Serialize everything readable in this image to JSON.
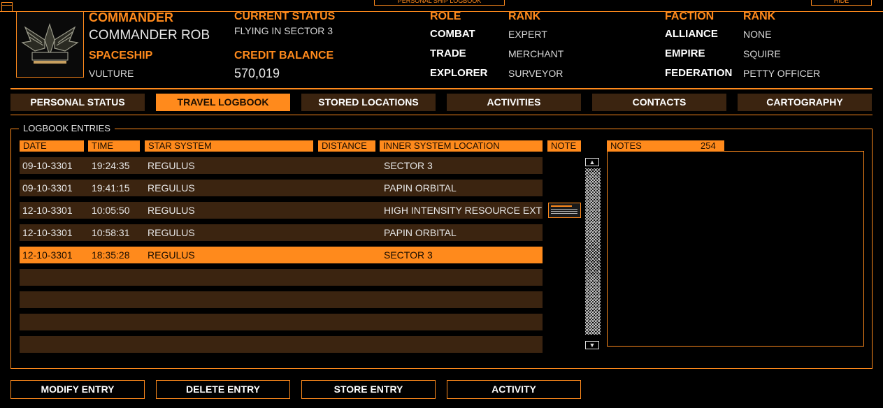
{
  "window": {
    "title": "PERSONAL SHIP LOGBOOK",
    "hide_label": "HIDE"
  },
  "commander": {
    "label": "COMMANDER",
    "name": "COMMANDER ROB",
    "ship_label": "SPACESHIP",
    "ship": "VULTURE",
    "status_label": "CURRENT STATUS",
    "status": "FLYING IN SECTOR 3",
    "credit_label": "CREDIT BALANCE",
    "credits": "570,019"
  },
  "roles": {
    "role_header": "ROLE",
    "rank_header": "RANK",
    "items": [
      {
        "role": "COMBAT",
        "rank": "EXPERT"
      },
      {
        "role": "TRADE",
        "rank": "MERCHANT"
      },
      {
        "role": "EXPLORER",
        "rank": "SURVEYOR"
      }
    ]
  },
  "factions": {
    "faction_header": "FACTION",
    "rank_header": "RANK",
    "items": [
      {
        "faction": "ALLIANCE",
        "rank": "NONE"
      },
      {
        "faction": "EMPIRE",
        "rank": "SQUIRE"
      },
      {
        "faction": "FEDERATION",
        "rank": "PETTY OFFICER"
      }
    ]
  },
  "tabs": [
    "PERSONAL STATUS",
    "TRAVEL LOGBOOK",
    "STORED LOCATIONS",
    "ACTIVITIES",
    "CONTACTS",
    "CARTOGRAPHY"
  ],
  "active_tab": 1,
  "logbook": {
    "title": "LOGBOOK ENTRIES",
    "columns": [
      "DATE",
      "TIME",
      "STAR SYSTEM",
      "DISTANCE",
      "INNER SYSTEM LOCATION",
      "NOTE"
    ],
    "entries": [
      {
        "date": "09-10-3301",
        "time": "19:24:35",
        "system": "REGULUS",
        "distance": "",
        "location": "SECTOR 3"
      },
      {
        "date": "09-10-3301",
        "time": "19:41:15",
        "system": "REGULUS",
        "distance": "",
        "location": "PAPIN ORBITAL"
      },
      {
        "date": "12-10-3301",
        "time": "10:05:50",
        "system": "REGULUS",
        "distance": "",
        "location": "HIGH INTENSITY RESOURCE EXTR"
      },
      {
        "date": "12-10-3301",
        "time": "10:58:31",
        "system": "REGULUS",
        "distance": "",
        "location": "PAPIN ORBITAL"
      },
      {
        "date": "12-10-3301",
        "time": "18:35:28",
        "system": "REGULUS",
        "distance": "",
        "location": "SECTOR 3"
      }
    ],
    "selected_entry": 4,
    "empty_rows": 4
  },
  "notes": {
    "label": "NOTES",
    "count": "254"
  },
  "buttons": [
    "MODIFY ENTRY",
    "DELETE ENTRY",
    "STORE ENTRY",
    "ACTIVITY"
  ],
  "colors": {
    "accent": "#ff8a1c",
    "row_bg": "#3b2410",
    "background": "#000000"
  }
}
